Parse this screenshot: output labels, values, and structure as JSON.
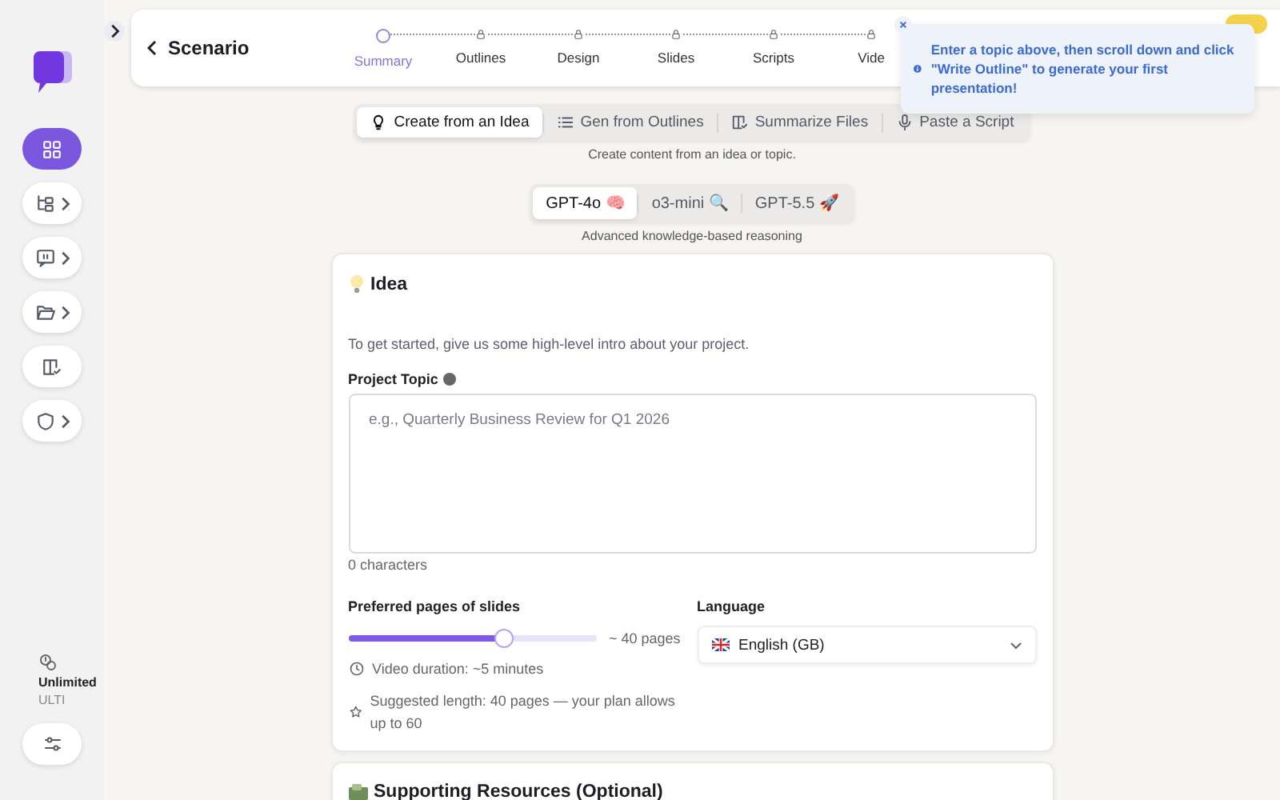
{
  "sidebar": {
    "nav": [
      {
        "kind": "grid",
        "selected": true,
        "has_submenu": false
      },
      {
        "kind": "tree",
        "selected": false,
        "has_submenu": true
      },
      {
        "kind": "chat",
        "selected": false,
        "has_submenu": true
      },
      {
        "kind": "folder",
        "selected": false,
        "has_submenu": true
      },
      {
        "kind": "book",
        "selected": false,
        "has_submenu": false
      },
      {
        "kind": "shield",
        "selected": false,
        "has_submenu": true
      }
    ],
    "plan": {
      "name": "Unlimited",
      "tier": "ULTI"
    }
  },
  "header": {
    "title": "Scenario",
    "steps": [
      {
        "label": "Summary",
        "locked": false
      },
      {
        "label": "Outlines",
        "locked": true
      },
      {
        "label": "Design",
        "locked": true
      },
      {
        "label": "Slides",
        "locked": true
      },
      {
        "label": "Scripts",
        "locked": true
      },
      {
        "label": "Vide",
        "locked": true
      }
    ]
  },
  "toast": {
    "message": "Enter a topic above, then scroll down and click \"Write Outline\" to generate your first presentation!"
  },
  "modes": {
    "tabs": [
      {
        "label": "Create from an Idea",
        "kind": "bulb",
        "selected": true
      },
      {
        "label": "Gen from Outlines",
        "kind": "list",
        "selected": false
      },
      {
        "label": "Summarize Files",
        "kind": "book",
        "selected": false
      },
      {
        "label": "Paste a Script",
        "kind": "mic",
        "selected": false
      }
    ],
    "hint": "Create content from an idea or topic."
  },
  "models": {
    "tabs": [
      {
        "label": "GPT-4o 🧠",
        "selected": true
      },
      {
        "label": "o3-mini 🔍",
        "selected": false
      },
      {
        "label": "GPT-5.5 🚀",
        "selected": false
      }
    ],
    "hint": "Advanced knowledge-based reasoning"
  },
  "idea_card": {
    "title": "Idea",
    "intro": "To get started, give us some high-level intro about your project.",
    "topic": {
      "label": "Project Topic",
      "placeholder": "e.g., Quarterly Business Review for Q1 2026",
      "count": "0 characters"
    },
    "pages": {
      "label": "Preferred pages of slides",
      "level": 0.63,
      "reading": "~ 40 pages"
    },
    "notes": [
      {
        "kind": "clock",
        "text": "Video duration: ~5 minutes"
      },
      {
        "kind": "star",
        "text": "Suggested length: 40 pages — your plan allows up to 60"
      }
    ],
    "language": {
      "label": "Language",
      "value": "English (GB)"
    }
  },
  "resources_card": {
    "title": "Supporting Resources (Optional)"
  }
}
